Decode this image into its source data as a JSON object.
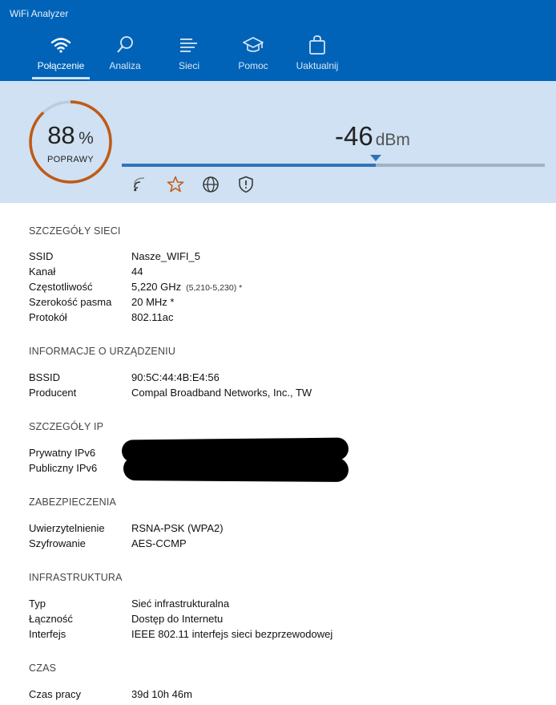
{
  "app": {
    "title": "WiFi Analyzer"
  },
  "tabs": [
    {
      "label": "Połączenie",
      "icon": "wifi-icon",
      "active": true
    },
    {
      "label": "Analiza",
      "icon": "magnifier-icon",
      "active": false
    },
    {
      "label": "Sieci",
      "icon": "list-icon",
      "active": false
    },
    {
      "label": "Pomoc",
      "icon": "graduation-cap-icon",
      "active": false
    },
    {
      "label": "Uaktualnij",
      "icon": "shopping-bag-icon",
      "active": false
    }
  ],
  "signal": {
    "quality_value": "88",
    "quality_unit": "%",
    "quality_caption": "POPRAWY",
    "quality_fraction": 0.88,
    "dbm_value": "-46",
    "dbm_unit": "dBm",
    "bar_fraction": 0.6,
    "icons": [
      "signal-bars-icon",
      "star-icon",
      "globe-icon",
      "shield-icon"
    ]
  },
  "sections": {
    "network": {
      "title": "SZCZEGÓŁY SIECI",
      "rows": [
        {
          "k": "SSID",
          "v": "Nasze_WIFI_5",
          "extra": ""
        },
        {
          "k": "Kanał",
          "v": "44",
          "extra": ""
        },
        {
          "k": "Częstotliwość",
          "v": "5,220 GHz",
          "extra": "(5,210-5,230) *"
        },
        {
          "k": "Szerokość pasma",
          "v": "20 MHz *",
          "extra": ""
        },
        {
          "k": "Protokół",
          "v": "802.11ac",
          "extra": ""
        }
      ]
    },
    "device": {
      "title": "INFORMACJE O URZĄDZENIU",
      "rows": [
        {
          "k": "BSSID",
          "v": "90:5C:44:4B:E4:56"
        },
        {
          "k": "Producent",
          "v": "Compal Broadband Networks, Inc., TW"
        }
      ]
    },
    "ip": {
      "title": "SZCZEGÓŁY IP",
      "rows": [
        {
          "k": "Prywatny IPv6",
          "v": ""
        },
        {
          "k": "Publiczny IPv6",
          "v": ""
        }
      ]
    },
    "security": {
      "title": "ZABEZPIECZENIA",
      "rows": [
        {
          "k": "Uwierzytelnienie",
          "v": "RSNA-PSK (WPA2)"
        },
        {
          "k": "Szyfrowanie",
          "v": "AES-CCMP"
        }
      ]
    },
    "infra": {
      "title": "INFRASTRUKTURA",
      "rows": [
        {
          "k": "Typ",
          "v": "Sieć infrastrukturalna"
        },
        {
          "k": "Łączność",
          "v": "Dostęp do Internetu"
        },
        {
          "k": "Interfejs",
          "v": "IEEE 802.11 interfejs sieci bezprzewodowej"
        }
      ]
    },
    "time": {
      "title": "CZAS",
      "rows": [
        {
          "k": "Czas pracy",
          "v": "39d 10h 46m"
        }
      ]
    }
  },
  "colors": {
    "header": "#0063b8",
    "panel": "#cfe1f2",
    "gauge_arc": "#c05a14",
    "gauge_track": "#b9cde0",
    "bar_fill": "#2f74b8",
    "icon_star": "#c05a14"
  }
}
